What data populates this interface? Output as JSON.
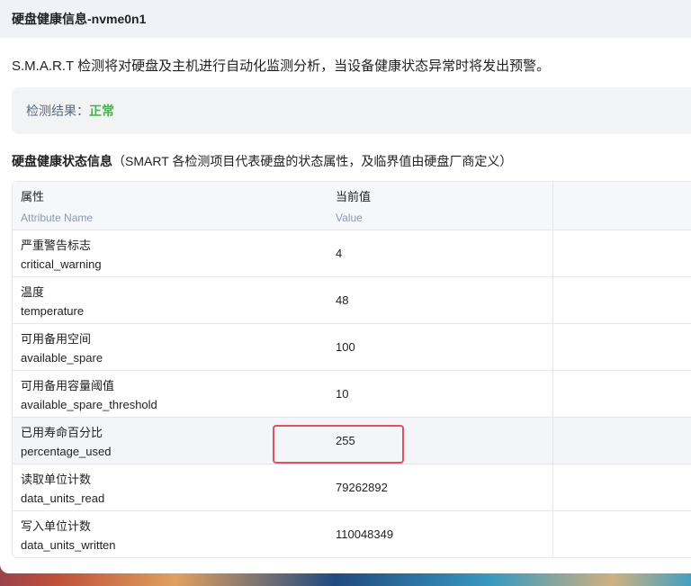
{
  "header": {
    "title": "硬盘健康信息-nvme0n1"
  },
  "description": "S.M.A.R.T 检测将对硬盘及主机进行自动化监测分析，当设备健康状态异常时将发出预警。",
  "result": {
    "label": "检测结果：",
    "value": "正常"
  },
  "section": {
    "title": "硬盘健康状态信息",
    "note": "（SMART 各检测项目代表硬盘的状态属性，及临界值由硬盘厂商定义）"
  },
  "table": {
    "headers": [
      {
        "label": "属性",
        "sub": "Attribute Name"
      },
      {
        "label": "当前值",
        "sub": "Value"
      }
    ],
    "rows": [
      {
        "name_cn": "严重警告标志",
        "name": "critical_warning",
        "value": "4"
      },
      {
        "name_cn": "温度",
        "name": "temperature",
        "value": "48"
      },
      {
        "name_cn": "可用备用空间",
        "name": "available_spare",
        "value": "100"
      },
      {
        "name_cn": "可用备用容量阈值",
        "name": "available_spare_threshold",
        "value": "10"
      },
      {
        "name_cn": "已用寿命百分比",
        "name": "percentage_used",
        "value": "255"
      },
      {
        "name_cn": "读取单位计数",
        "name": "data_units_read",
        "value": "79262892"
      },
      {
        "name_cn": "写入单位计数",
        "name": "data_units_written",
        "value": "110048349"
      }
    ]
  },
  "colors": {
    "ok": "#4caf50",
    "highlight": "#e05060"
  }
}
